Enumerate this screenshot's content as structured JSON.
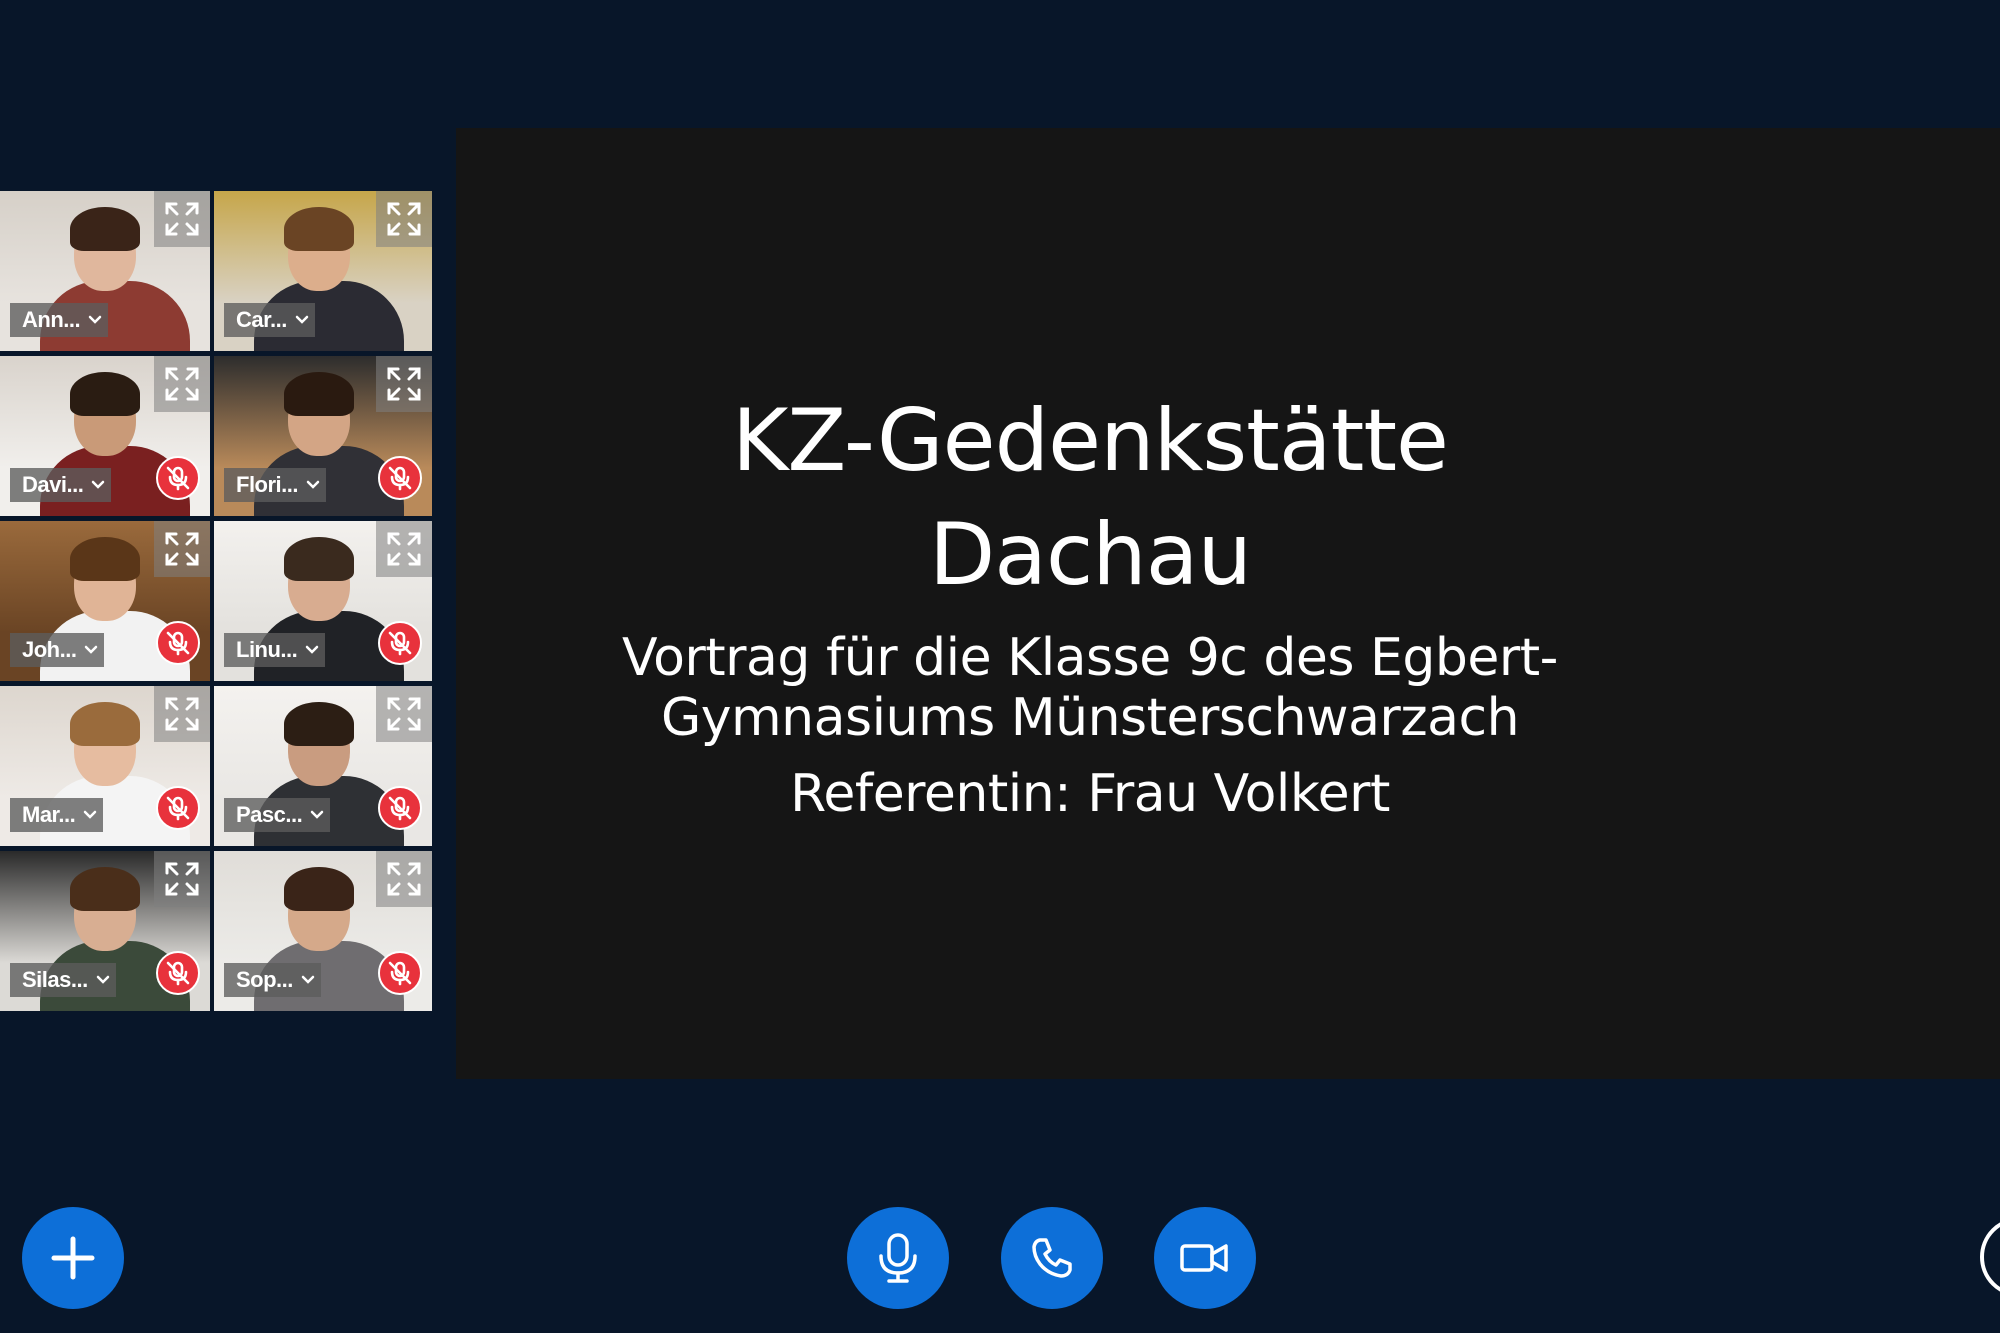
{
  "participants": [
    {
      "name": "Ann...",
      "muted": false,
      "colors": {
        "bg": "#e7e3de",
        "wall": "#d6d0c8",
        "skin": "#e0b79d",
        "hair": "#3a2418",
        "shirt": "#8d3b32"
      }
    },
    {
      "name": "Car...",
      "muted": false,
      "colors": {
        "bg": "#d9d2c4",
        "wall": "#c6a64a",
        "skin": "#dcae8c",
        "hair": "#6a4424",
        "shirt": "#2b2b33"
      }
    },
    {
      "name": "Davi...",
      "muted": true,
      "colors": {
        "bg": "#f1efec",
        "wall": "#d9d3cc",
        "skin": "#c99a78",
        "hair": "#2a1c12",
        "shirt": "#7a2020"
      }
    },
    {
      "name": "Flori...",
      "muted": true,
      "colors": {
        "bg": "#b98a5a",
        "wall": "#2d2d2d",
        "skin": "#d3a585",
        "hair": "#2a1a10",
        "shirt": "#303036"
      }
    },
    {
      "name": "Joh...",
      "muted": true,
      "colors": {
        "bg": "#6a4424",
        "wall": "#9a6a3c",
        "skin": "#e0b496",
        "hair": "#5a3618",
        "shirt": "#f2f2f2"
      }
    },
    {
      "name": "Linu...",
      "muted": true,
      "colors": {
        "bg": "#e3e1dd",
        "wall": "#f3f1ee",
        "skin": "#d8ac90",
        "hair": "#3a2a1e",
        "shirt": "#202226"
      }
    },
    {
      "name": "Mar...",
      "muted": true,
      "colors": {
        "bg": "#eeeae6",
        "wall": "#ddd6ce",
        "skin": "#e6bca0",
        "hair": "#9a6b3c",
        "shirt": "#f4f4f4"
      }
    },
    {
      "name": "Pasc...",
      "muted": true,
      "colors": {
        "bg": "#e9e7e4",
        "wall": "#f4f2ef",
        "skin": "#c99c80",
        "hair": "#2c1e14",
        "shirt": "#2e3034"
      }
    },
    {
      "name": "Silas...",
      "muted": true,
      "colors": {
        "bg": "#dcdad6",
        "wall": "#2a2a2a",
        "skin": "#d8ae92",
        "hair": "#4a2e1a",
        "shirt": "#3b4a3a"
      }
    },
    {
      "name": "Sop...",
      "muted": true,
      "colors": {
        "bg": "#ecebe8",
        "wall": "#e0ddd8",
        "skin": "#d5a98a",
        "hair": "#3a2418",
        "shirt": "#6f6d70"
      }
    }
  ],
  "slide": {
    "title_line1": "KZ-Gedenkstätte",
    "title_line2": "Dachau",
    "subtitle_line1": "Vortrag für die Klasse 9c des Egbert-",
    "subtitle_line2": "Gymnasiums Münsterschwarzach",
    "speaker": "Referentin: Frau Volkert"
  },
  "controls": {
    "add_icon": "plus-icon",
    "mic_icon": "microphone-icon",
    "call_icon": "phone-icon",
    "video_icon": "video-camera-icon"
  },
  "theme": {
    "background": "#081629",
    "slide_background": "#151515",
    "accent": "#0d6fd8",
    "mute_badge": "#e8323c"
  }
}
